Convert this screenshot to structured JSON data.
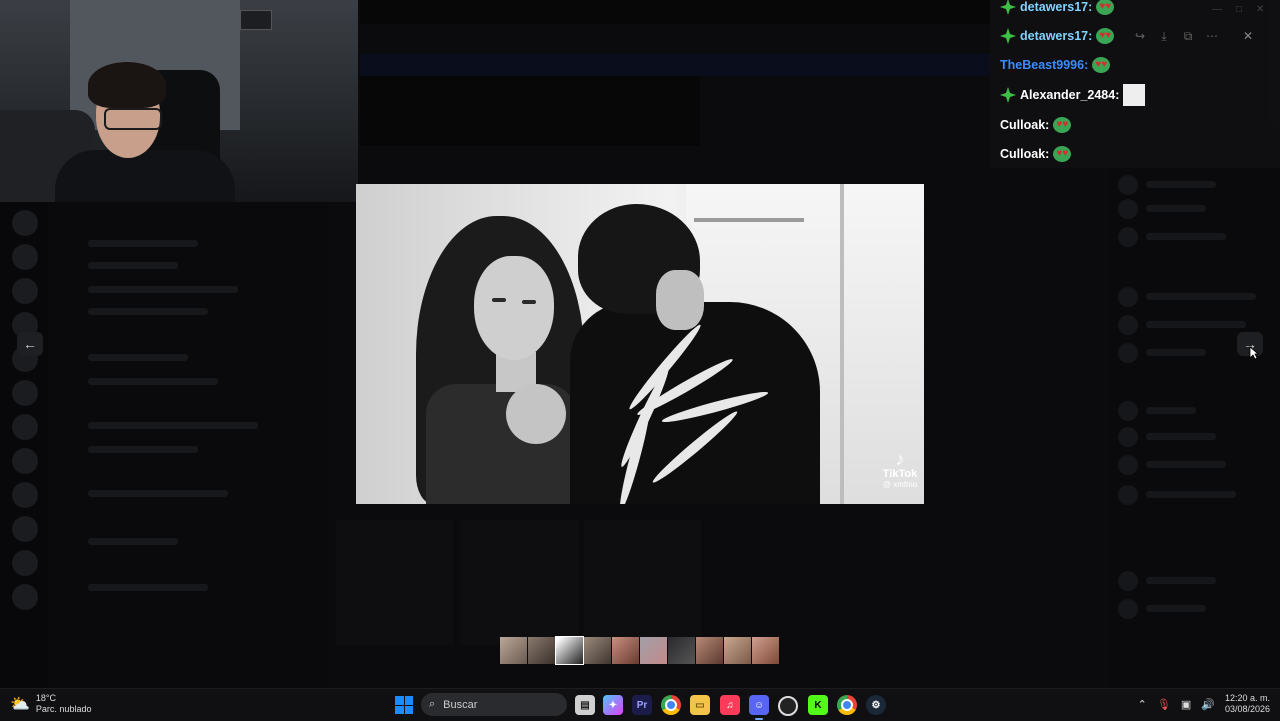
{
  "chat": {
    "messages": [
      {
        "user": "detawers17:",
        "color": "#7fd3ff",
        "badge": "crown-badge",
        "emote": "heart-eyes-emote"
      },
      {
        "user": "detawers17:",
        "color": "#7fd3ff",
        "badge": "crown-badge",
        "emote": "heart-eyes-emote"
      },
      {
        "user": "TheBeast9996:",
        "color": "#3a8cff",
        "badge": "",
        "emote": "heart-eyes-emote"
      },
      {
        "user": "Alexander_2484:",
        "color": "#ffffff",
        "badge": "crown-badge",
        "emote": "image-emote"
      },
      {
        "user": "Culloak:",
        "color": "#ffffff",
        "badge": "",
        "emote": "heart-eyes-emote"
      },
      {
        "user": "Culloak:",
        "color": "#ffffff",
        "badge": "",
        "emote": "heart-eyes-emote"
      }
    ],
    "badge_color": "#3ec046"
  },
  "media": {
    "watermark_brand": "TikTok",
    "watermark_user": "@ xmfmo"
  },
  "viewer": {
    "prev_icon": "arrow-left-icon",
    "next_icon": "arrow-right-icon",
    "thumbnail_count": 10,
    "active_thumbnail": 3
  },
  "taskbar": {
    "weather_temp": "18°C",
    "weather_desc": "Parc. nublado",
    "search_placeholder": "Buscar",
    "time": "12:20 a. m.",
    "date": "03/08/2026",
    "apps": [
      "file-explorer-icon",
      "copilot-icon",
      "premiere-icon",
      "chrome-icon",
      "folder-icon",
      "music-icon",
      "discord-icon",
      "obs-icon",
      "kick-icon",
      "chrome-profile-icon",
      "steam-icon"
    ],
    "accent": "#1a8cff"
  }
}
